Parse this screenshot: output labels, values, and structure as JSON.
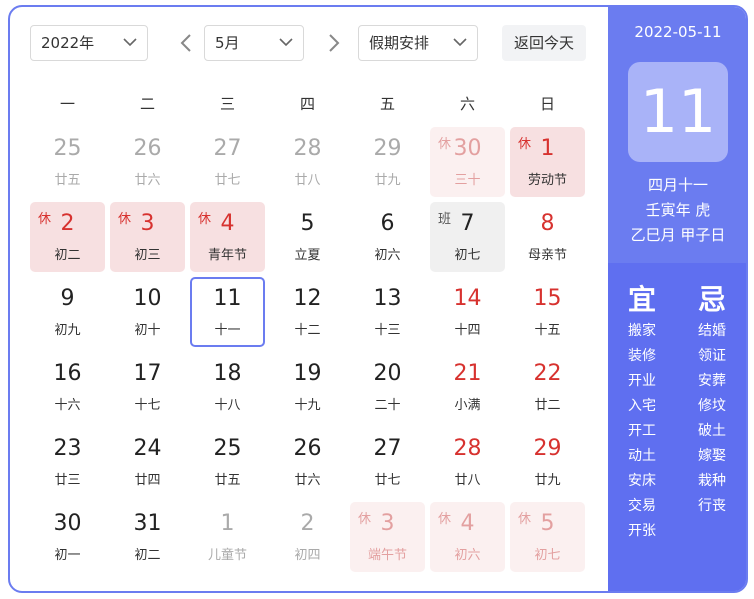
{
  "toolbar": {
    "year": "2022年",
    "month": "5月",
    "holiday": "假期安排",
    "today_btn": "返回今天"
  },
  "weekdays": [
    "一",
    "二",
    "三",
    "四",
    "五",
    "六",
    "日"
  ],
  "days": [
    {
      "num": "25",
      "lunar": "廿五",
      "other": true
    },
    {
      "num": "26",
      "lunar": "廿六",
      "other": true
    },
    {
      "num": "27",
      "lunar": "廿七",
      "other": true
    },
    {
      "num": "28",
      "lunar": "廿八",
      "other": true
    },
    {
      "num": "29",
      "lunar": "廿九",
      "other": true
    },
    {
      "num": "30",
      "lunar": "三十",
      "other": true,
      "tag": "休",
      "kind": "holiday"
    },
    {
      "num": "1",
      "lunar": "劳动节",
      "tag": "休",
      "kind": "holiday"
    },
    {
      "num": "2",
      "lunar": "初二",
      "tag": "休",
      "kind": "holiday"
    },
    {
      "num": "3",
      "lunar": "初三",
      "tag": "休",
      "kind": "holiday"
    },
    {
      "num": "4",
      "lunar": "青年节",
      "tag": "休",
      "kind": "holiday"
    },
    {
      "num": "5",
      "lunar": "立夏"
    },
    {
      "num": "6",
      "lunar": "初六"
    },
    {
      "num": "7",
      "lunar": "初七",
      "tag": "班",
      "kind": "work"
    },
    {
      "num": "8",
      "lunar": "母亲节",
      "weekend": true
    },
    {
      "num": "9",
      "lunar": "初九"
    },
    {
      "num": "10",
      "lunar": "初十"
    },
    {
      "num": "11",
      "lunar": "十一",
      "selected": true
    },
    {
      "num": "12",
      "lunar": "十二"
    },
    {
      "num": "13",
      "lunar": "十三"
    },
    {
      "num": "14",
      "lunar": "十四",
      "weekend": true
    },
    {
      "num": "15",
      "lunar": "十五",
      "weekend": true
    },
    {
      "num": "16",
      "lunar": "十六"
    },
    {
      "num": "17",
      "lunar": "十七"
    },
    {
      "num": "18",
      "lunar": "十八"
    },
    {
      "num": "19",
      "lunar": "十九"
    },
    {
      "num": "20",
      "lunar": "二十"
    },
    {
      "num": "21",
      "lunar": "小满",
      "weekend": true
    },
    {
      "num": "22",
      "lunar": "廿二",
      "weekend": true
    },
    {
      "num": "23",
      "lunar": "廿三"
    },
    {
      "num": "24",
      "lunar": "廿四"
    },
    {
      "num": "25",
      "lunar": "廿五"
    },
    {
      "num": "26",
      "lunar": "廿六"
    },
    {
      "num": "27",
      "lunar": "廿七"
    },
    {
      "num": "28",
      "lunar": "廿八",
      "weekend": true
    },
    {
      "num": "29",
      "lunar": "廿九",
      "weekend": true
    },
    {
      "num": "30",
      "lunar": "初一"
    },
    {
      "num": "31",
      "lunar": "初二"
    },
    {
      "num": "1",
      "lunar": "儿童节",
      "other": true
    },
    {
      "num": "2",
      "lunar": "初四",
      "other": true
    },
    {
      "num": "3",
      "lunar": "端午节",
      "other": true,
      "tag": "休",
      "kind": "holiday"
    },
    {
      "num": "4",
      "lunar": "初六",
      "other": true,
      "tag": "休",
      "kind": "holiday"
    },
    {
      "num": "5",
      "lunar": "初七",
      "other": true,
      "tag": "休",
      "kind": "holiday"
    }
  ],
  "panel": {
    "date": "2022-05-11",
    "day": "11",
    "lunar_date": "四月十一",
    "year_gz": "壬寅年 虎",
    "month_day_gz": "乙巳月 甲子日",
    "yi_title": "宜",
    "ji_title": "忌",
    "yi": [
      "搬家",
      "装修",
      "开业",
      "入宅",
      "开工",
      "动土",
      "安床",
      "交易",
      "开张"
    ],
    "ji": [
      "结婚",
      "领证",
      "安葬",
      "修坟",
      "破土",
      "嫁娶",
      "栽种",
      "行丧"
    ]
  },
  "colors": {
    "accent": "#6b7cf0",
    "holiday_bg": "#f7e0e1",
    "red": "#d7322f"
  }
}
